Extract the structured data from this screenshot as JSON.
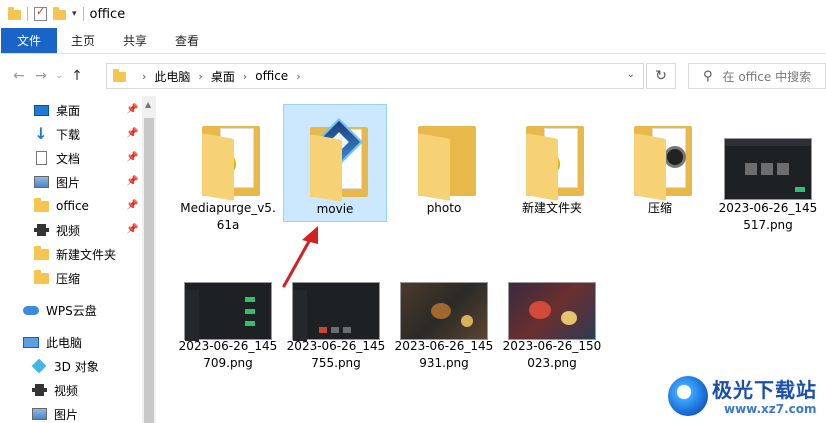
{
  "window": {
    "title": "office"
  },
  "ribbon": {
    "tabs": [
      "文件",
      "主页",
      "共享",
      "查看"
    ]
  },
  "address": {
    "crumbs": [
      "此电脑",
      "桌面",
      "office"
    ]
  },
  "search": {
    "placeholder": "在 office 中搜索"
  },
  "sidebar": {
    "items": [
      {
        "label": "桌面",
        "icon": "desktop-icon",
        "pinned": true
      },
      {
        "label": "下载",
        "icon": "download-icon",
        "pinned": true
      },
      {
        "label": "文档",
        "icon": "document-icon",
        "pinned": true
      },
      {
        "label": "图片",
        "icon": "picture-icon",
        "pinned": true
      },
      {
        "label": "office",
        "icon": "folder-icon",
        "pinned": true
      },
      {
        "label": "视频",
        "icon": "video-icon",
        "pinned": true
      },
      {
        "label": "新建文件夹",
        "icon": "folder-icon",
        "pinned": false
      },
      {
        "label": "压缩",
        "icon": "folder-icon",
        "pinned": false
      },
      {
        "label": "WPS云盘",
        "icon": "cloud-icon",
        "pinned": false
      },
      {
        "label": "此电脑",
        "icon": "computer-icon",
        "pinned": false
      },
      {
        "label": "3D 对象",
        "icon": "3d-objects-icon",
        "pinned": false
      },
      {
        "label": "视频",
        "icon": "video-icon",
        "pinned": false
      },
      {
        "label": "图片",
        "icon": "picture-icon",
        "pinned": false
      }
    ]
  },
  "files": [
    {
      "name": "Mediapurge_v5.61a",
      "type": "folder",
      "selected": false
    },
    {
      "name": "movie",
      "type": "folder",
      "selected": true
    },
    {
      "name": "photo",
      "type": "folder",
      "selected": false
    },
    {
      "name": "新建文件夹",
      "type": "folder",
      "selected": false
    },
    {
      "name": "压缩",
      "type": "folder",
      "selected": false
    },
    {
      "name": "2023-06-26_145517.png",
      "type": "image",
      "selected": false
    },
    {
      "name": "2023-06-26_145709.png",
      "type": "image",
      "selected": false
    },
    {
      "name": "2023-06-26_145755.png",
      "type": "image",
      "selected": false
    },
    {
      "name": "2023-06-26_145931.png",
      "type": "image",
      "selected": false
    },
    {
      "name": "2023-06-26_150023.png",
      "type": "image",
      "selected": false
    }
  ],
  "watermark": {
    "text": "极光下载站",
    "url": "www.xz7.com"
  },
  "colors": {
    "accent": "#1a63c7",
    "selection": "#cce8ff",
    "folder": "#f5c451"
  }
}
